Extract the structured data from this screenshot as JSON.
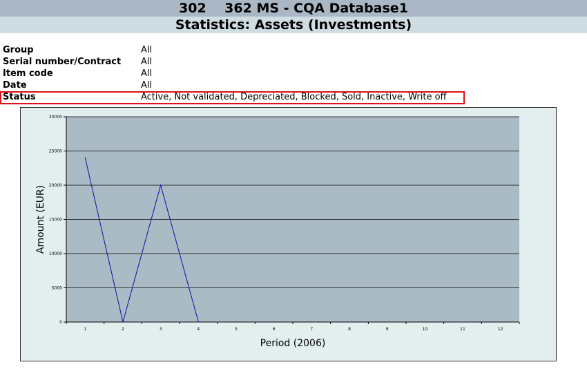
{
  "header": {
    "title": "302    362 MS - CQA Database1",
    "subtitle": "Statistics: Assets (Investments)"
  },
  "filters": [
    {
      "label": "Group",
      "value": "All"
    },
    {
      "label": "Serial number/Contract",
      "value": "All"
    },
    {
      "label": "Item code",
      "value": "All"
    },
    {
      "label": "Date",
      "value": "All"
    },
    {
      "label": "Status",
      "value": "Active, Not validated, Depreciated, Blocked, Sold, Inactive, Write off"
    }
  ],
  "colors": {
    "plot_background": "#abbbc6",
    "chart_background": "#e3eeee",
    "line": "#1a1aa0",
    "highlight": "#e0101a"
  },
  "chart_data": {
    "type": "line",
    "xlabel": "Period (2006)",
    "ylabel": "Amount (EUR)",
    "categories": [
      "1",
      "2",
      "3",
      "4",
      "5",
      "6",
      "7",
      "8",
      "9",
      "10",
      "11",
      "12"
    ],
    "y_ticks": [
      "0",
      "5000",
      "10000",
      "15000",
      "20000",
      "25000",
      "30000"
    ],
    "ylim": [
      0,
      30000
    ],
    "grid": true,
    "series": [
      {
        "values": [
          24000,
          0,
          20000,
          0
        ]
      }
    ]
  }
}
